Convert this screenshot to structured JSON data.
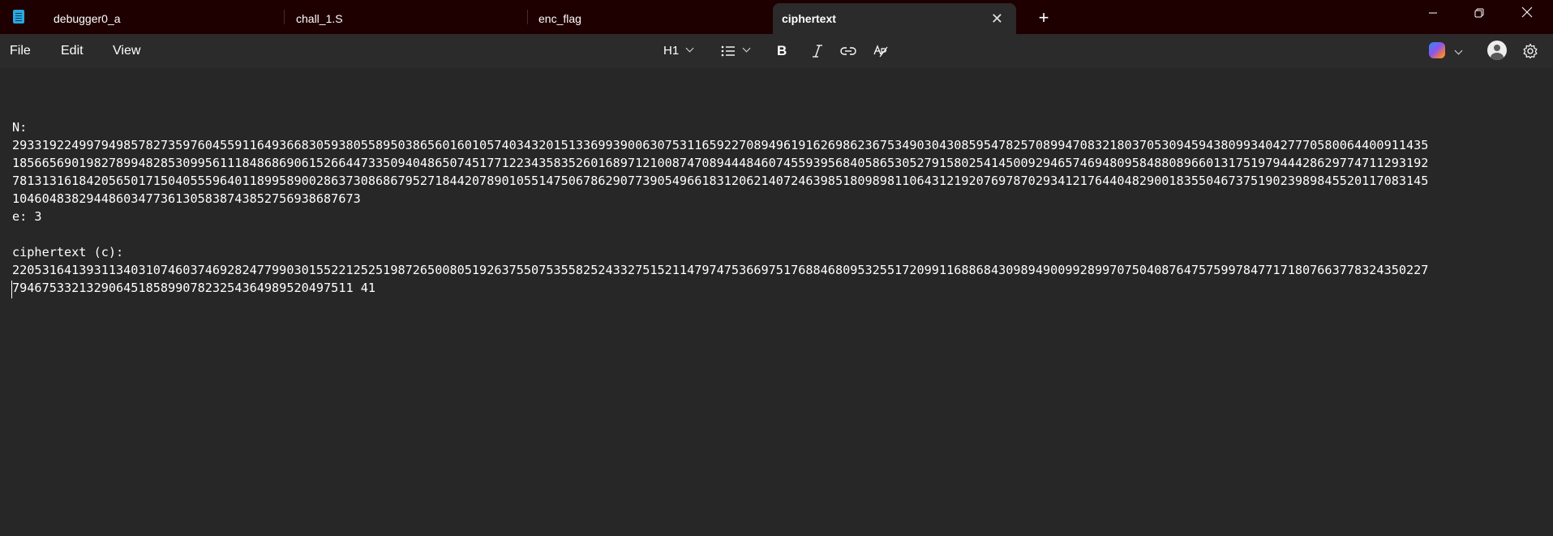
{
  "tabs": [
    {
      "label": "debugger0_a"
    },
    {
      "label": "chall_1.S"
    },
    {
      "label": "enc_flag"
    },
    {
      "label": "ciphertext"
    }
  ],
  "active_tab": "ciphertext",
  "menu": {
    "file": "File",
    "edit": "Edit",
    "view": "View"
  },
  "toolbar": {
    "heading": "H1"
  },
  "document": {
    "lines": [
      "",
      "N:",
      "29331922499794985782735976045591164936683059380558950386560160105740343201513369939006307531165922708949619162698623675349030430859547825708994708321803705309459438099340427770580064400911435",
      "18566569019827899482853099561118486869061526644733509404865074517712234358352601689712100874708944484607455939568405865305279158025414500929465746948095848808966013175197944428629774711293192",
      "78131316184205650171504055596401189958900286373086867952718442078901055147506786290773905496618312062140724639851809898110643121920769787029341217644048290018355046737519023989845520117083145",
      "10460483829448603477361305838743852756938687673",
      "e: 3",
      "",
      "ciphertext (c):",
      "22053164139311340310746037469282477990301552212525198726500805192637550753558252433275152114797475366975176884680953255172099116886843098949009928997075040876475759978477171807663778324350227",
      "7946753321329064518589907823254364989520497511 41"
    ]
  }
}
